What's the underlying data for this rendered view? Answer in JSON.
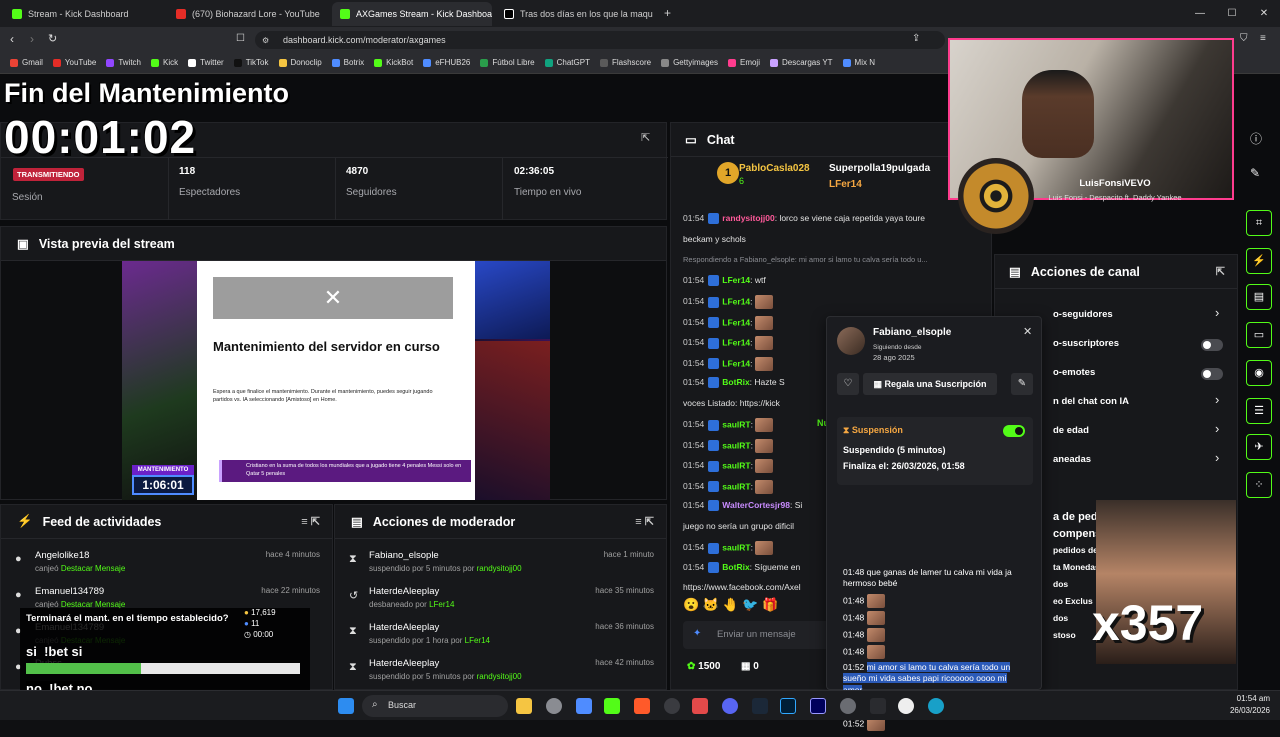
{
  "tabs": [
    {
      "label": "Stream - Kick Dashboard",
      "color": "#53fc18"
    },
    {
      "label": "(670) Biohazard Lore - YouTube",
      "color": "#e52d27"
    },
    {
      "label": "AXGames Stream - Kick Dashboa",
      "color": "#53fc18"
    },
    {
      "label": "Tras dos días en los que la maqu",
      "color": "#ffffff"
    }
  ],
  "address": {
    "url": "dashboard.kick.com/moderator/axgames"
  },
  "bookmarks": [
    "Gmail",
    "YouTube",
    "Twitch",
    "Kick",
    "Twitter",
    "TikTok",
    "Donoclip",
    "Botrix",
    "KickBot",
    "eFHUB26",
    "Fútbol Libre",
    "ChatGPT",
    "Flashscore",
    "Gettyimages",
    "Emoji",
    "Descargas YT",
    "Mix N"
  ],
  "overlay": {
    "title": "Fin del Mantenimiento",
    "timer": "00:01:02"
  },
  "stats": {
    "status_badge": "TRANSMITIENDO",
    "session_label": "Sesión",
    "viewers_value": "118",
    "viewers_label": "Espectadores",
    "followers_value": "4870",
    "followers_label": "Seguidores",
    "live_value": "02:36:05",
    "live_label": "Tiempo en vivo"
  },
  "preview": {
    "heading": "Vista previa del stream",
    "maint_title": "Mantenimiento del servidor en curso",
    "maint_body": "Espera a que finalice el mantenimiento. Durante el mantenimiento, puedes seguir jugando partidos vs. IA seleccionando [Amistoso] en Home.",
    "ticker": "Cristiano en la suma de todos los mundiales que a jugado tiene 4 penales Messi solo en Qatar 5 penales",
    "mant_label": "MANTENIMIENTO",
    "mant_timer": "1:06:01"
  },
  "feed": {
    "heading": "Feed de actividades",
    "items": [
      {
        "name": "Angelolike18",
        "action": "canjeó",
        "reward": "Destacar Mensaje",
        "time": "hace 4 minutos"
      },
      {
        "name": "Emanuel134789",
        "action": "canjeó",
        "reward": "Destacar Mensaje",
        "time": "hace 22 minutos"
      },
      {
        "name": "Emanuel134789",
        "action": "canjeó",
        "reward": "Destacar Mensaje",
        "time": ""
      },
      {
        "name": "Dubss",
        "action": "",
        "reward": "",
        "time": ""
      }
    ]
  },
  "poll": {
    "question": "Terminará el mant. en el tiempo establecido?",
    "points": "17,619",
    "users": "11",
    "time": "00:00",
    "option_a": "si",
    "cmd_a": "!bet si",
    "share_a": 0.42,
    "option_b": "no",
    "cmd_b": "!bet no",
    "share_b": 0.5
  },
  "modlog": {
    "heading": "Acciones de moderador",
    "items": [
      {
        "name": "Fabiano_elsople",
        "action": "suspendido por 5 minutos por",
        "by": "randysitojj00",
        "time": "hace 1 minuto",
        "icon": "hourglass-icon"
      },
      {
        "name": "HaterdeAleeplay",
        "action": "desbaneado por",
        "by": "LFer14",
        "time": "hace 35 minutos",
        "icon": "undo-icon"
      },
      {
        "name": "HaterdeAleeplay",
        "action": "suspendido por 1 hora por",
        "by": "LFer14",
        "time": "hace 36 minutos",
        "icon": "hourglass-icon"
      },
      {
        "name": "HaterdeAleeplay",
        "action": "suspendido por 5 minutos por",
        "by": "randysitojj00",
        "time": "hace 42 minutos",
        "icon": "hourglass-icon"
      }
    ]
  },
  "chat": {
    "heading": "Chat",
    "top": [
      {
        "name": "PabloCasla028",
        "count": "6"
      },
      {
        "name": "Superpolla19pulgada",
        "count": "3"
      },
      {
        "name": "LFer14",
        "count": "2"
      }
    ],
    "lines": [
      {
        "time": "01:54",
        "user": "randysitojj00",
        "text": ": lorco se viene caja repetida yaya toure"
      },
      {
        "time": "",
        "user": "",
        "text": "beckam y schols"
      },
      {
        "time": "",
        "user": "",
        "text": "Respondiendo a Fabiano_elsople: mi amor si lamo tu calva sería todo u..."
      },
      {
        "time": "01:54",
        "user": "LFer14",
        "text": ": wtf"
      },
      {
        "time": "01:54",
        "user": "LFer14",
        "text": ":"
      },
      {
        "time": "01:54",
        "user": "LFer14",
        "text": ":"
      },
      {
        "time": "01:54",
        "user": "LFer14",
        "text": ":"
      },
      {
        "time": "01:54",
        "user": "LFer14",
        "text": ":"
      },
      {
        "time": "01:54",
        "user": "BotRix",
        "text": ": Hazte S"
      },
      {
        "time": "",
        "user": "",
        "text": "voces  Listado: https://kick"
      },
      {
        "time": "01:54",
        "user": "saulRT",
        "text": ":"
      },
      {
        "time": "01:54",
        "user": "saulRT",
        "text": ":"
      },
      {
        "time": "01:54",
        "user": "saulRT",
        "text": ":"
      },
      {
        "time": "01:54",
        "user": "saulRT",
        "text": ":"
      },
      {
        "time": "01:54",
        "user": "WalterCortesjr98",
        "text": ": Si"
      },
      {
        "time": "",
        "user": "",
        "text": "juego no sería un grupo dificil"
      },
      {
        "time": "01:54",
        "user": "saulRT",
        "text": ":"
      },
      {
        "time": "01:54",
        "user": "BotRix",
        "text": ": Sígueme en"
      },
      {
        "time": "",
        "user": "",
        "text": "https://www.facebook.com/Axel"
      }
    ],
    "new_label": "Nuevo",
    "input_placeholder": "Enviar un mensaje",
    "points": "1500",
    "gifts": "0"
  },
  "user_card": {
    "name": "Fabiano_elsople",
    "following_label": "Siguiendo desde",
    "following_date": "28 ago 2025",
    "gift_button": "Regala una Suscripción",
    "suspension_title": "Suspensión",
    "suspension_detail": "Suspendido (5 minutos)",
    "suspension_end": "Finaliza el: 26/03/2026, 01:58",
    "messages": [
      {
        "time": "01:48",
        "text": "que ganas de lamer tu calva mi vida ja hermoso bebé"
      },
      {
        "time": "01:48",
        "text": ""
      },
      {
        "time": "01:48",
        "text": ""
      },
      {
        "time": "01:48",
        "text": ""
      },
      {
        "time": "01:48",
        "text": ""
      },
      {
        "time": "01:52",
        "text": "mi amor si lamo tu calva sería todo un sueño mi vida sabes papi ricooooo oooo mi amor"
      },
      {
        "time": "01:52",
        "text": ""
      },
      {
        "time": "01:52",
        "text": ""
      }
    ]
  },
  "channel_actions": {
    "heading": "Acciones de canal",
    "items": [
      "o-seguidores",
      "o-suscriptores",
      "o-emotes",
      "n del chat con IA",
      "de edad",
      "aneadas"
    ],
    "partial": [
      "a de ped",
      "compens",
      "pedidos de",
      "ta Monedas",
      "dos",
      "eo Exclus",
      "dos",
      "stoso"
    ]
  },
  "music": {
    "artist": "LuisFonsiVEVO",
    "song": "Luis Fonsi - Despacito ft. Daddy Yankee"
  },
  "meme_overlay": {
    "text": "x357"
  },
  "taskbar": {
    "search": "Buscar",
    "time": "01:54 am",
    "date": "26/03/2026"
  }
}
